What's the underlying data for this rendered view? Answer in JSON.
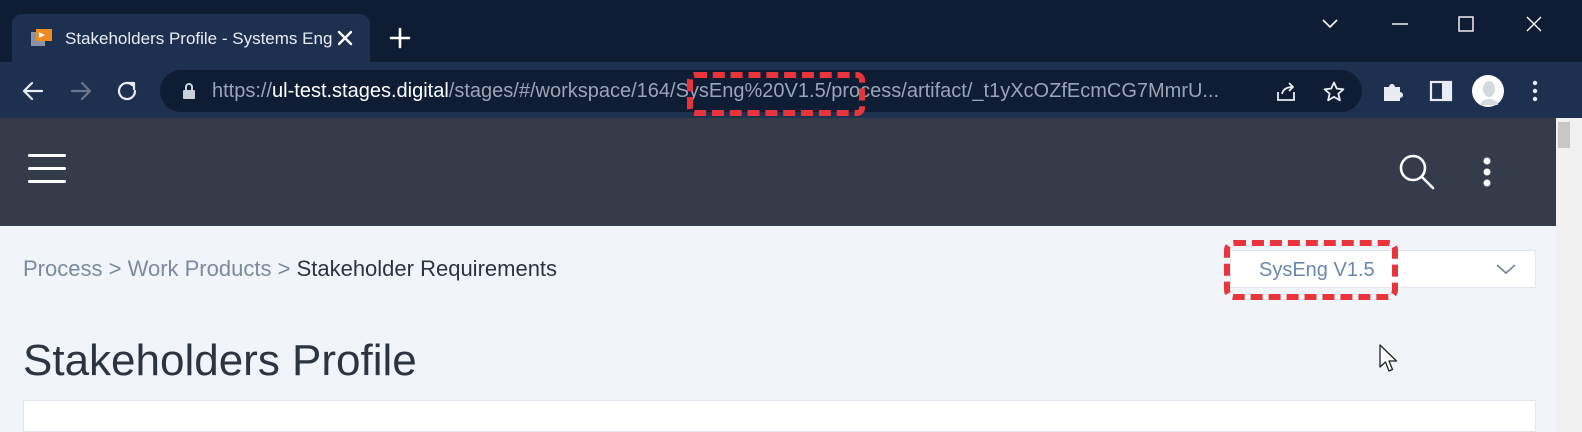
{
  "browser": {
    "tab": {
      "title": "Stakeholders Profile - Systems Engineering",
      "favicon": "stages-favicon"
    },
    "new_tab_icon": "plus-icon",
    "window_controls": [
      "tab-search-icon",
      "minimize-icon",
      "maximize-icon",
      "close-icon"
    ],
    "address_bar": {
      "scheme": "https://",
      "host": "ul-test.stages.digital",
      "path": "/stages/#/workspace/164/SysEng%20V1.5/process/artifact/_t1yXcOZfEcmCG7MmrU..."
    },
    "toolbar_icons": [
      "back-icon",
      "forward-icon",
      "reload-icon",
      "lock-icon",
      "share-icon",
      "bookmark-star-icon",
      "extensions-icon",
      "side-panel-icon",
      "profile-avatar",
      "menu-icon"
    ]
  },
  "app": {
    "header_icons": [
      "hamburger-menu-icon",
      "search-icon",
      "kebab-menu-icon"
    ],
    "breadcrumb": {
      "items": [
        "Process",
        "Work Products"
      ],
      "separator": ">",
      "current": "Stakeholder Requirements"
    },
    "version_select": {
      "selected": "SysEng V1.5"
    },
    "page_title": "Stakeholders Profile"
  },
  "colors": {
    "tabstrip_bg": "#0e1c34",
    "toolbar_bg": "#1e3050",
    "app_header_bg": "#343c4a",
    "page_bg": "#f1f4f8",
    "highlight_red": "#e8353c",
    "link_gray": "#7b8aa0",
    "version_blue": "#6a88b0"
  }
}
